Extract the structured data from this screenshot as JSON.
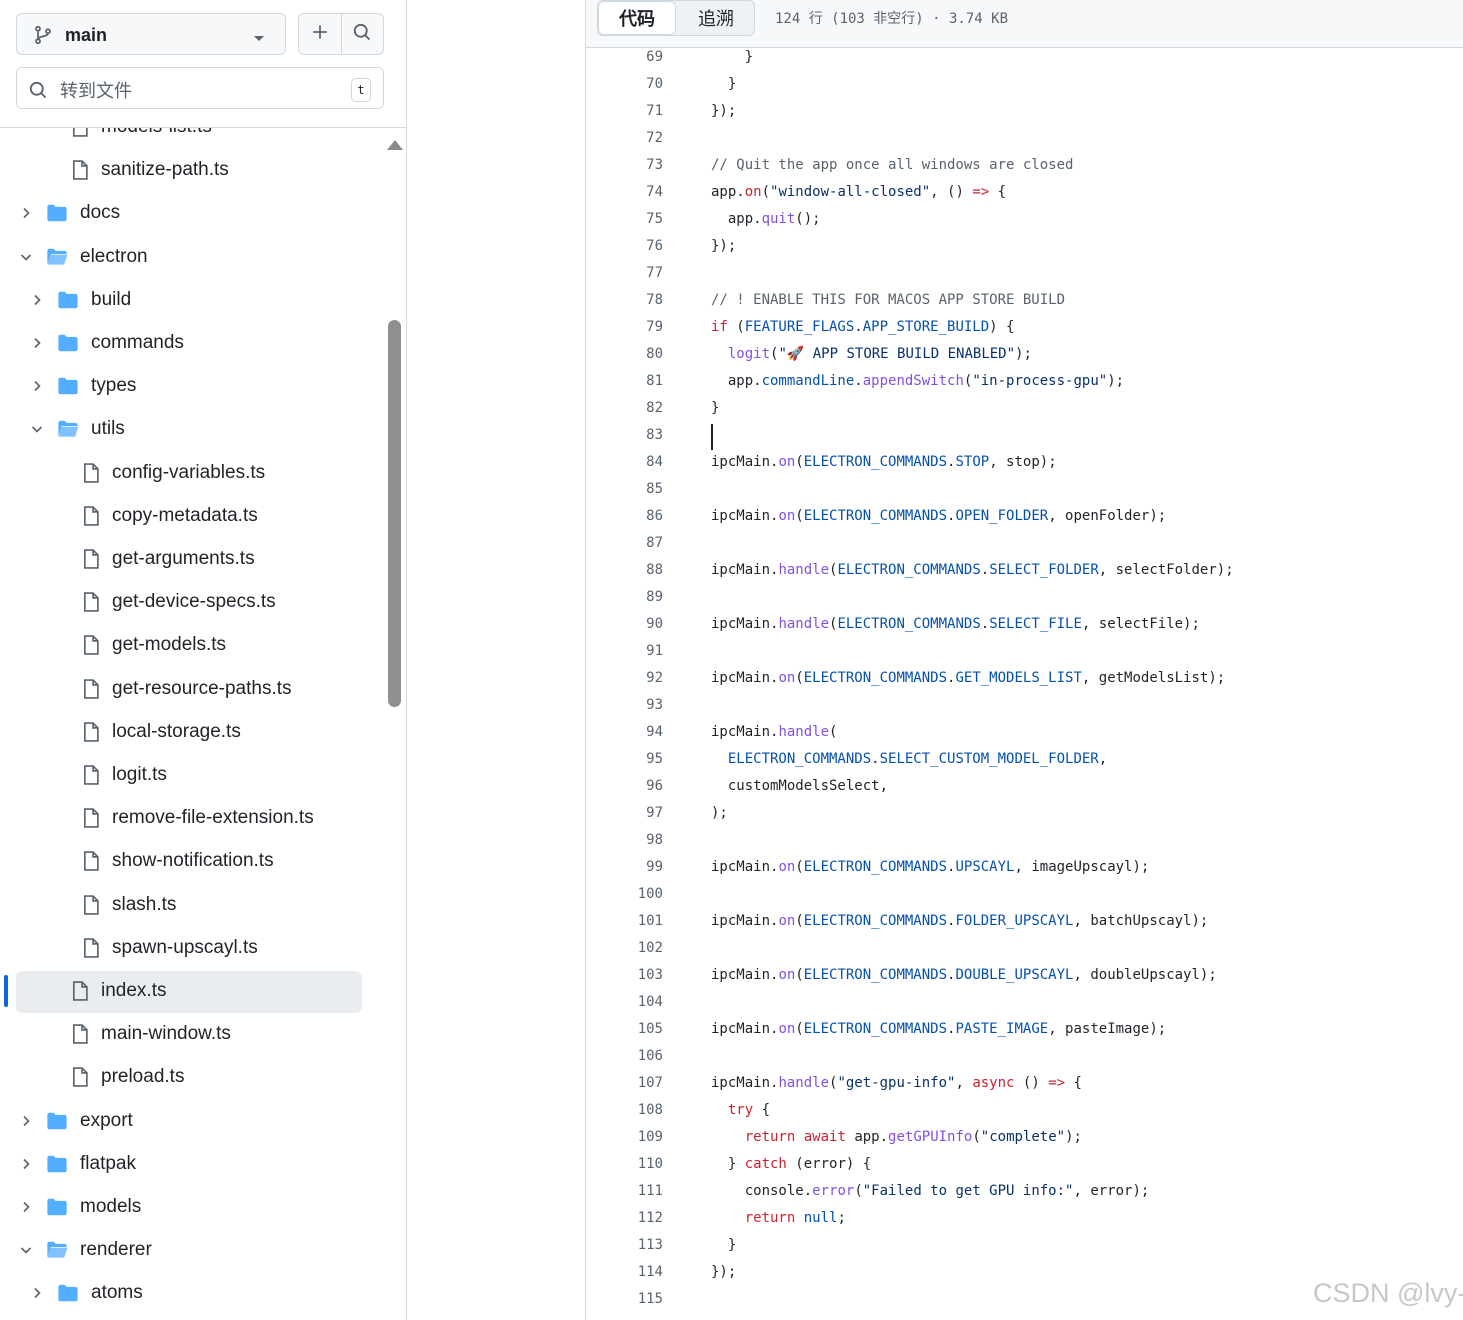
{
  "sidebar": {
    "branch": "main",
    "search_placeholder": "转到文件",
    "search_shortcut": "t",
    "tree": [
      {
        "label": "models-list.ts",
        "type": "file",
        "depth": 1
      },
      {
        "label": "sanitize-path.ts",
        "type": "file",
        "depth": 1
      },
      {
        "label": "docs",
        "type": "folder",
        "depth": 0,
        "expanded": false
      },
      {
        "label": "electron",
        "type": "folder",
        "depth": 0,
        "expanded": true
      },
      {
        "label": "build",
        "type": "folder",
        "depth": 1,
        "expanded": false
      },
      {
        "label": "commands",
        "type": "folder",
        "depth": 1,
        "expanded": false
      },
      {
        "label": "types",
        "type": "folder",
        "depth": 1,
        "expanded": false
      },
      {
        "label": "utils",
        "type": "folder",
        "depth": 1,
        "expanded": true
      },
      {
        "label": "config-variables.ts",
        "type": "file",
        "depth": 2
      },
      {
        "label": "copy-metadata.ts",
        "type": "file",
        "depth": 2
      },
      {
        "label": "get-arguments.ts",
        "type": "file",
        "depth": 2
      },
      {
        "label": "get-device-specs.ts",
        "type": "file",
        "depth": 2
      },
      {
        "label": "get-models.ts",
        "type": "file",
        "depth": 2
      },
      {
        "label": "get-resource-paths.ts",
        "type": "file",
        "depth": 2
      },
      {
        "label": "local-storage.ts",
        "type": "file",
        "depth": 2
      },
      {
        "label": "logit.ts",
        "type": "file",
        "depth": 2
      },
      {
        "label": "remove-file-extension.ts",
        "type": "file",
        "depth": 2
      },
      {
        "label": "show-notification.ts",
        "type": "file",
        "depth": 2
      },
      {
        "label": "slash.ts",
        "type": "file",
        "depth": 2
      },
      {
        "label": "spawn-upscayl.ts",
        "type": "file",
        "depth": 2
      },
      {
        "label": "index.ts",
        "type": "file",
        "depth": 1,
        "selected": true
      },
      {
        "label": "main-window.ts",
        "type": "file",
        "depth": 1
      },
      {
        "label": "preload.ts",
        "type": "file",
        "depth": 1
      },
      {
        "label": "export",
        "type": "folder",
        "depth": 0,
        "expanded": false
      },
      {
        "label": "flatpak",
        "type": "folder",
        "depth": 0,
        "expanded": false
      },
      {
        "label": "models",
        "type": "folder",
        "depth": 0,
        "expanded": false
      },
      {
        "label": "renderer",
        "type": "folder",
        "depth": 0,
        "expanded": true
      },
      {
        "label": "atoms",
        "type": "folder",
        "depth": 1,
        "expanded": false
      }
    ]
  },
  "code_view": {
    "tab_code": "代码",
    "tab_blame": "追溯",
    "file_meta": "124 行 (103 非空行) · 3.74 KB",
    "lines": [
      {
        "n": "69",
        "tokens": [
          [
            "t",
            "    }"
          ]
        ]
      },
      {
        "n": "70",
        "tokens": [
          [
            "t",
            "  }"
          ]
        ]
      },
      {
        "n": "71",
        "tokens": [
          [
            "t",
            "});"
          ]
        ]
      },
      {
        "n": "72",
        "tokens": []
      },
      {
        "n": "73",
        "tokens": [
          [
            "c",
            "// Quit the app once all windows are closed"
          ]
        ]
      },
      {
        "n": "74",
        "tokens": [
          [
            "t",
            "app."
          ],
          [
            "k",
            "on"
          ],
          [
            "t",
            "("
          ],
          [
            "s",
            "\"window-all-closed\""
          ],
          [
            "t",
            ", () "
          ],
          [
            "k",
            "=>"
          ],
          [
            "t",
            " {"
          ]
        ]
      },
      {
        "n": "75",
        "tokens": [
          [
            "t",
            "  app."
          ],
          [
            "f",
            "quit"
          ],
          [
            "t",
            "();"
          ]
        ]
      },
      {
        "n": "76",
        "tokens": [
          [
            "t",
            "});"
          ]
        ]
      },
      {
        "n": "77",
        "tokens": []
      },
      {
        "n": "78",
        "tokens": [
          [
            "c",
            "// ! ENABLE THIS FOR MACOS APP STORE BUILD"
          ]
        ]
      },
      {
        "n": "79",
        "tokens": [
          [
            "k",
            "if"
          ],
          [
            "t",
            " ("
          ],
          [
            "v",
            "FEATURE_FLAGS"
          ],
          [
            "t",
            "."
          ],
          [
            "v",
            "APP_STORE_BUILD"
          ],
          [
            "t",
            ") {"
          ]
        ]
      },
      {
        "n": "80",
        "tokens": [
          [
            "t",
            "  "
          ],
          [
            "f",
            "logit"
          ],
          [
            "t",
            "("
          ],
          [
            "s",
            "\"🚀 APP STORE BUILD ENABLED\""
          ],
          [
            "t",
            ");"
          ]
        ]
      },
      {
        "n": "81",
        "tokens": [
          [
            "t",
            "  app."
          ],
          [
            "v",
            "commandLine"
          ],
          [
            "t",
            "."
          ],
          [
            "f",
            "appendSwitch"
          ],
          [
            "t",
            "("
          ],
          [
            "s",
            "\"in-process-gpu\""
          ],
          [
            "t",
            ");"
          ]
        ]
      },
      {
        "n": "82",
        "tokens": [
          [
            "t",
            "}"
          ]
        ]
      },
      {
        "n": "83",
        "tokens": []
      },
      {
        "n": "84",
        "tokens": [
          [
            "t",
            "ipcMain."
          ],
          [
            "f",
            "on"
          ],
          [
            "t",
            "("
          ],
          [
            "v",
            "ELECTRON_COMMANDS"
          ],
          [
            "t",
            "."
          ],
          [
            "v",
            "STOP"
          ],
          [
            "t",
            ", stop);"
          ]
        ]
      },
      {
        "n": "85",
        "tokens": []
      },
      {
        "n": "86",
        "tokens": [
          [
            "t",
            "ipcMain."
          ],
          [
            "f",
            "on"
          ],
          [
            "t",
            "("
          ],
          [
            "v",
            "ELECTRON_COMMANDS"
          ],
          [
            "t",
            "."
          ],
          [
            "v",
            "OPEN_FOLDER"
          ],
          [
            "t",
            ", openFolder);"
          ]
        ]
      },
      {
        "n": "87",
        "tokens": []
      },
      {
        "n": "88",
        "tokens": [
          [
            "t",
            "ipcMain."
          ],
          [
            "f",
            "handle"
          ],
          [
            "t",
            "("
          ],
          [
            "v",
            "ELECTRON_COMMANDS"
          ],
          [
            "t",
            "."
          ],
          [
            "v",
            "SELECT_FOLDER"
          ],
          [
            "t",
            ", selectFolder);"
          ]
        ]
      },
      {
        "n": "89",
        "tokens": []
      },
      {
        "n": "90",
        "tokens": [
          [
            "t",
            "ipcMain."
          ],
          [
            "f",
            "handle"
          ],
          [
            "t",
            "("
          ],
          [
            "v",
            "ELECTRON_COMMANDS"
          ],
          [
            "t",
            "."
          ],
          [
            "v",
            "SELECT_FILE"
          ],
          [
            "t",
            ", selectFile);"
          ]
        ]
      },
      {
        "n": "91",
        "tokens": []
      },
      {
        "n": "92",
        "tokens": [
          [
            "t",
            "ipcMain."
          ],
          [
            "f",
            "on"
          ],
          [
            "t",
            "("
          ],
          [
            "v",
            "ELECTRON_COMMANDS"
          ],
          [
            "t",
            "."
          ],
          [
            "v",
            "GET_MODELS_LIST"
          ],
          [
            "t",
            ", getModelsList);"
          ]
        ]
      },
      {
        "n": "93",
        "tokens": []
      },
      {
        "n": "94",
        "tokens": [
          [
            "t",
            "ipcMain."
          ],
          [
            "f",
            "handle"
          ],
          [
            "t",
            "("
          ]
        ]
      },
      {
        "n": "95",
        "tokens": [
          [
            "t",
            "  "
          ],
          [
            "v",
            "ELECTRON_COMMANDS"
          ],
          [
            "t",
            "."
          ],
          [
            "v",
            "SELECT_CUSTOM_MODEL_FOLDER"
          ],
          [
            "t",
            ","
          ]
        ]
      },
      {
        "n": "96",
        "tokens": [
          [
            "t",
            "  customModelsSelect,"
          ]
        ]
      },
      {
        "n": "97",
        "tokens": [
          [
            "t",
            ");"
          ]
        ]
      },
      {
        "n": "98",
        "tokens": []
      },
      {
        "n": "99",
        "tokens": [
          [
            "t",
            "ipcMain."
          ],
          [
            "f",
            "on"
          ],
          [
            "t",
            "("
          ],
          [
            "v",
            "ELECTRON_COMMANDS"
          ],
          [
            "t",
            "."
          ],
          [
            "v",
            "UPSCAYL"
          ],
          [
            "t",
            ", imageUpscayl);"
          ]
        ]
      },
      {
        "n": "100",
        "tokens": []
      },
      {
        "n": "101",
        "tokens": [
          [
            "t",
            "ipcMain."
          ],
          [
            "f",
            "on"
          ],
          [
            "t",
            "("
          ],
          [
            "v",
            "ELECTRON_COMMANDS"
          ],
          [
            "t",
            "."
          ],
          [
            "v",
            "FOLDER_UPSCAYL"
          ],
          [
            "t",
            ", batchUpscayl);"
          ]
        ]
      },
      {
        "n": "102",
        "tokens": []
      },
      {
        "n": "103",
        "tokens": [
          [
            "t",
            "ipcMain."
          ],
          [
            "f",
            "on"
          ],
          [
            "t",
            "("
          ],
          [
            "v",
            "ELECTRON_COMMANDS"
          ],
          [
            "t",
            "."
          ],
          [
            "v",
            "DOUBLE_UPSCAYL"
          ],
          [
            "t",
            ", doubleUpscayl);"
          ]
        ]
      },
      {
        "n": "104",
        "tokens": []
      },
      {
        "n": "105",
        "tokens": [
          [
            "t",
            "ipcMain."
          ],
          [
            "f",
            "on"
          ],
          [
            "t",
            "("
          ],
          [
            "v",
            "ELECTRON_COMMANDS"
          ],
          [
            "t",
            "."
          ],
          [
            "v",
            "PASTE_IMAGE"
          ],
          [
            "t",
            ", pasteImage);"
          ]
        ]
      },
      {
        "n": "106",
        "tokens": []
      },
      {
        "n": "107",
        "tokens": [
          [
            "t",
            "ipcMain."
          ],
          [
            "f",
            "handle"
          ],
          [
            "t",
            "("
          ],
          [
            "s",
            "\"get-gpu-info\""
          ],
          [
            "t",
            ", "
          ],
          [
            "k",
            "async"
          ],
          [
            "t",
            " () "
          ],
          [
            "k",
            "=>"
          ],
          [
            "t",
            " {"
          ]
        ]
      },
      {
        "n": "108",
        "tokens": [
          [
            "t",
            "  "
          ],
          [
            "k",
            "try"
          ],
          [
            "t",
            " {"
          ]
        ]
      },
      {
        "n": "109",
        "tokens": [
          [
            "t",
            "    "
          ],
          [
            "k",
            "return"
          ],
          [
            "t",
            " "
          ],
          [
            "k",
            "await"
          ],
          [
            "t",
            " app."
          ],
          [
            "f",
            "getGPUInfo"
          ],
          [
            "t",
            "("
          ],
          [
            "s",
            "\"complete\""
          ],
          [
            "t",
            ");"
          ]
        ]
      },
      {
        "n": "110",
        "tokens": [
          [
            "t",
            "  } "
          ],
          [
            "k",
            "catch"
          ],
          [
            "t",
            " (error) {"
          ]
        ]
      },
      {
        "n": "111",
        "tokens": [
          [
            "t",
            "    console."
          ],
          [
            "f",
            "error"
          ],
          [
            "t",
            "("
          ],
          [
            "s",
            "\"Failed to get GPU info:\""
          ],
          [
            "t",
            ", error);"
          ]
        ]
      },
      {
        "n": "112",
        "tokens": [
          [
            "t",
            "    "
          ],
          [
            "k",
            "return"
          ],
          [
            "t",
            " "
          ],
          [
            "v",
            "null"
          ],
          [
            "t",
            ";"
          ]
        ]
      },
      {
        "n": "113",
        "tokens": [
          [
            "t",
            "  }"
          ]
        ]
      },
      {
        "n": "114",
        "tokens": [
          [
            "t",
            "});"
          ]
        ]
      },
      {
        "n": "115",
        "tokens": []
      }
    ]
  },
  "watermark": "CSDN @lvy-",
  "colors": {
    "keyword": "#cf222e",
    "string": "#0a3069",
    "comment": "#59636e",
    "function": "#8250df",
    "constant": "#0550ae",
    "folder": "#54aeff",
    "selection_bar": "#0969da"
  }
}
